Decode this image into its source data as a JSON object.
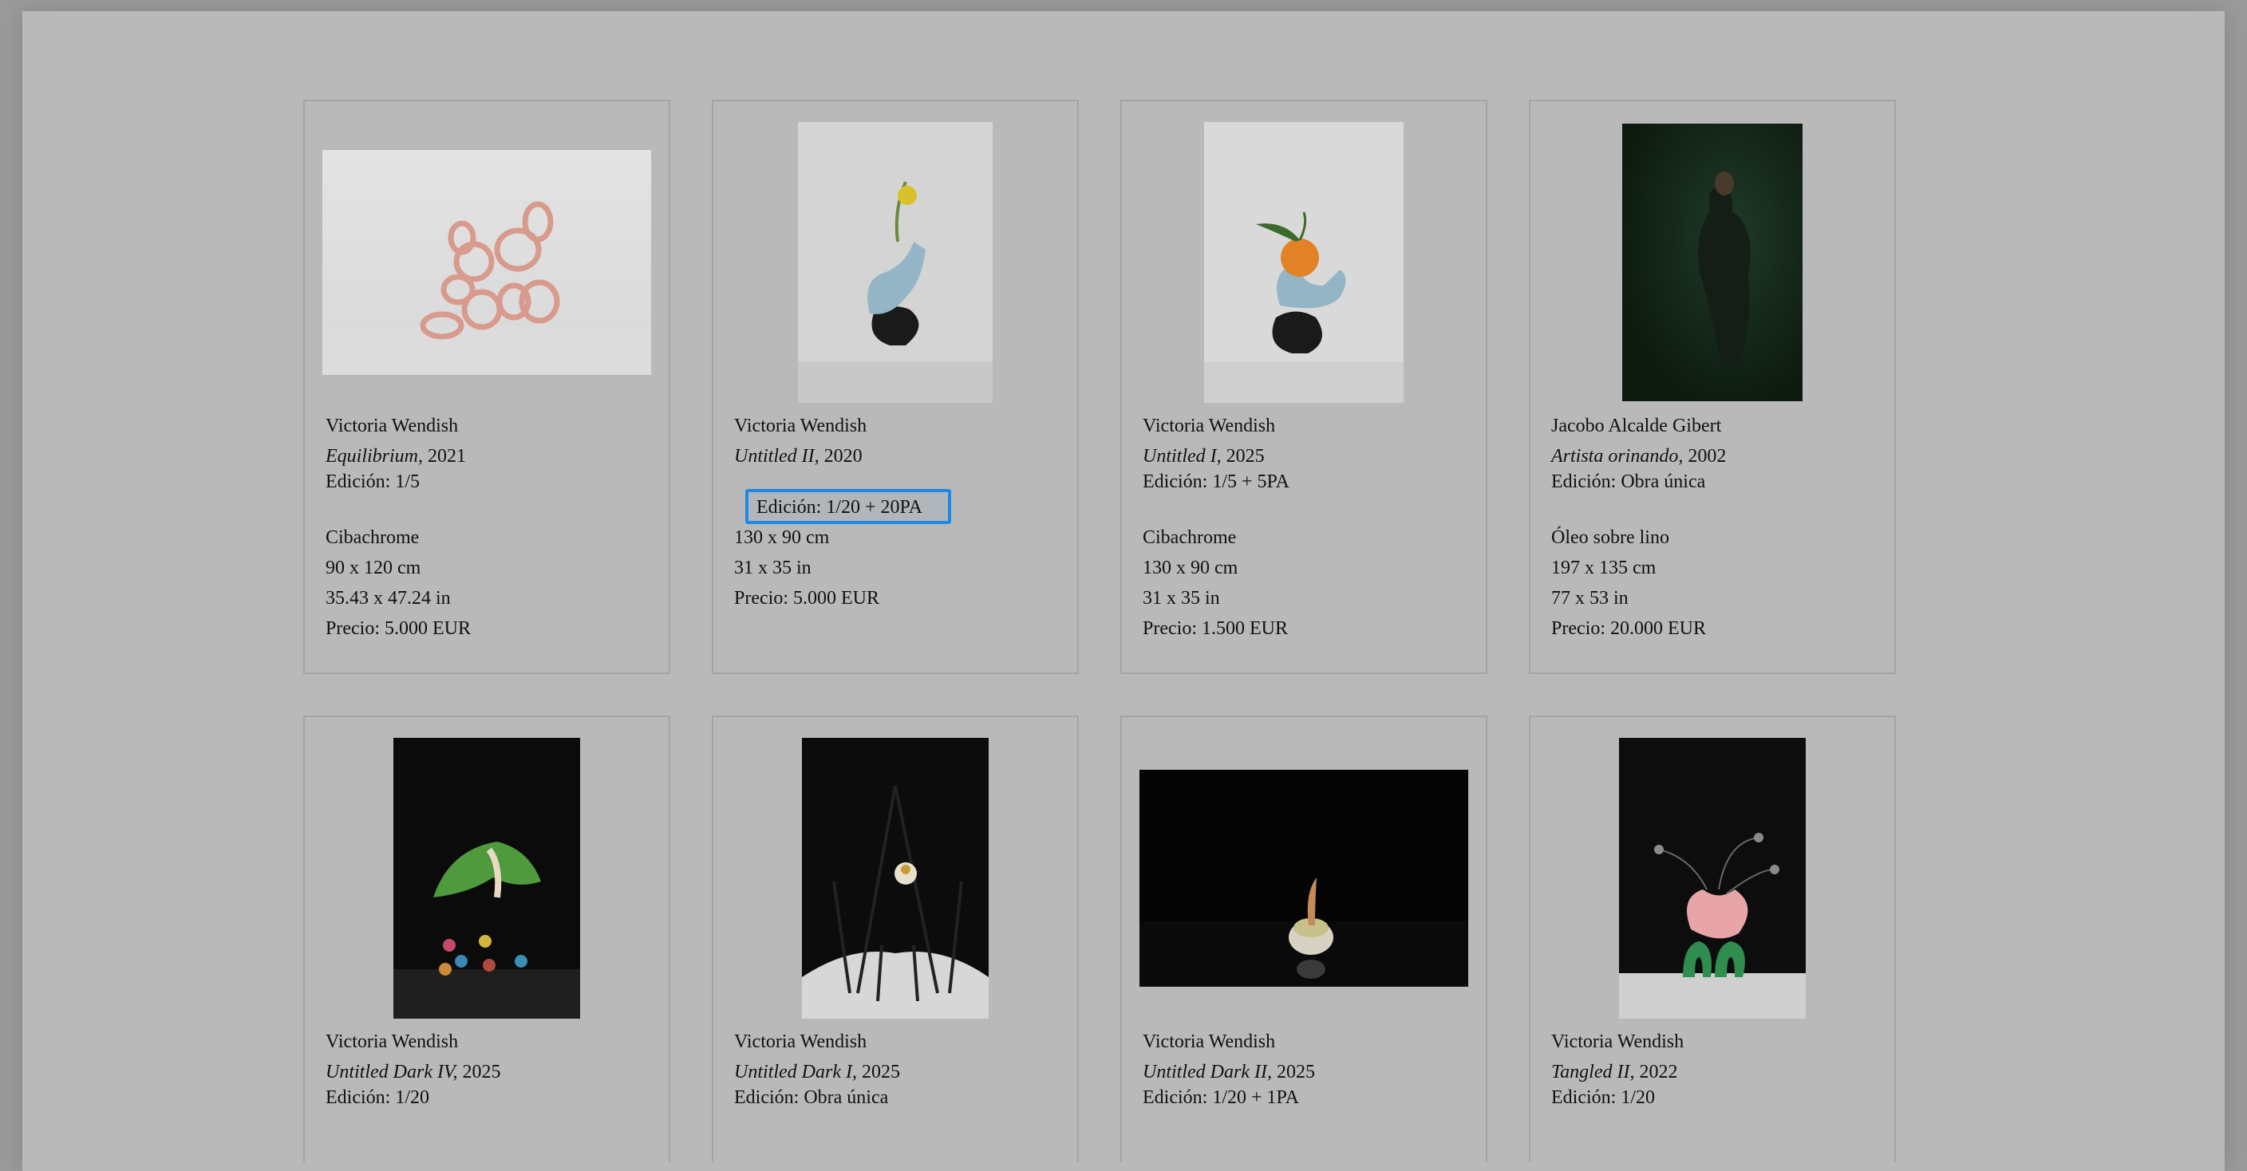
{
  "colors": {
    "page_bg": "#b9b9b9",
    "highlight": "#1e88e5"
  },
  "artworks": [
    {
      "artist": "Victoria Wendish",
      "title": "Equilibrium,",
      "year": "2021",
      "edition": "Edición: 1/5",
      "details": [
        "Cibachrome",
        "90 x 120 cm",
        "35.43 x 47.24 in",
        "Precio: 5.000 EUR"
      ]
    },
    {
      "artist": "Victoria Wendish",
      "title": "Untitled II,",
      "year": "2020",
      "edition": "Edición: 1/20 + 20PA",
      "details": [
        "130 x 90 cm",
        "31 x 35 in",
        "Precio: 5.000 EUR"
      ]
    },
    {
      "artist": "Victoria Wendish",
      "title": "Untitled I,",
      "year": "2025",
      "edition": "Edición: 1/5 + 5PA",
      "details": [
        "Cibachrome",
        "130 x 90 cm",
        "31 x 35 in",
        "Precio: 1.500 EUR"
      ]
    },
    {
      "artist": "Jacobo Alcalde Gibert",
      "title": "Artista orinando,",
      "year": "2002",
      "edition": "Edición: Obra única",
      "details": [
        "Óleo sobre lino",
        "197 x 135 cm",
        "77 x 53 in",
        "Precio: 20.000 EUR"
      ]
    },
    {
      "artist": "Victoria Wendish",
      "title": "Untitled Dark IV,",
      "year": "2025",
      "edition": "Edición: 1/20",
      "details": []
    },
    {
      "artist": "Victoria Wendish",
      "title": "Untitled Dark I,",
      "year": "2025",
      "edition": "Edición: Obra única",
      "details": []
    },
    {
      "artist": "Victoria Wendish",
      "title": "Untitled Dark II,",
      "year": "2025",
      "edition": "Edición: 1/20 + 1PA",
      "details": []
    },
    {
      "artist": "Victoria Wendish",
      "title": "Tangled II,",
      "year": "2022",
      "edition": "Edición: 1/20",
      "details": []
    }
  ],
  "highlighted": {
    "text": "Edición: 1/20 + 20PA"
  }
}
